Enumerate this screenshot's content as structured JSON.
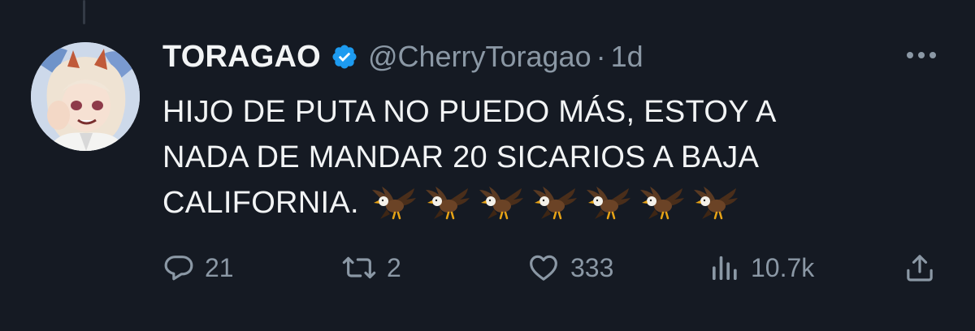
{
  "tweet": {
    "display_name": "TORAGAO",
    "handle": "@CherryToragao",
    "separator": "·",
    "time": "1d",
    "text_lines": [
      "HIJO DE PUTA NO PUEDO MÁS, ESTOY A",
      "NADA DE MANDAR 20 SICARIOS A BAJA",
      "CALIFORNIA."
    ],
    "eagle_emoji_count": 7
  },
  "icons": {
    "verified": "verified-badge-icon",
    "more": "more-options-icon",
    "reply": "reply-icon",
    "retweet": "retweet-icon",
    "like": "heart-icon",
    "views": "views-icon",
    "share": "share-icon",
    "eagle": "eagle-emoji-icon"
  },
  "stats": {
    "replies": "21",
    "retweets": "2",
    "likes": "333",
    "views": "10.7k"
  },
  "colors": {
    "background": "#151a23",
    "text": "#f2f4f5",
    "muted": "#8b98a5",
    "verified": "#1d9bf0"
  }
}
